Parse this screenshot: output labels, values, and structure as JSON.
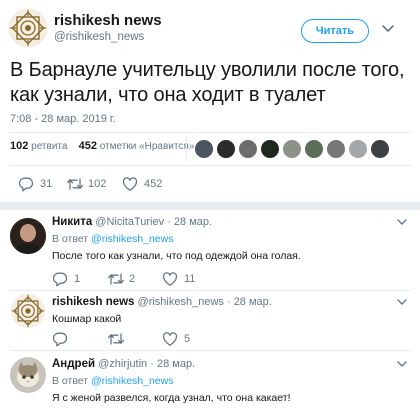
{
  "tweet": {
    "author_name": "rishikesh news",
    "author_handle": "@rishikesh_news",
    "follow_label": "Читать",
    "text": "В Барнауле учительцу уволили после того, как узнали, что она ходит в туалет",
    "time": "7:08 - 28 мар. 2019 г.",
    "retweets_count": "102",
    "retweets_label": "ретвита",
    "likes_count": "452",
    "likes_label": "отметки «Нравится»",
    "actions": {
      "reply": "31",
      "retweet": "102",
      "like": "452"
    }
  },
  "replies": [
    {
      "name": "Никита",
      "handle": "@NicitaTuriev",
      "date": "· 28 мар.",
      "reply_to_prefix": "В ответ",
      "reply_to_handle": "@rishikesh_news",
      "text": "После того как узнали, что под одеждой она голая.",
      "actions": {
        "reply": "1",
        "retweet": "2",
        "like": "11"
      }
    },
    {
      "name": "rishikesh news",
      "handle": "@rishikesh_news",
      "date": "· 28 мар.",
      "text": "Кошмар какой",
      "actions": {
        "reply": "",
        "retweet": "",
        "like": "5"
      }
    },
    {
      "name": "Андрей",
      "handle": "@zhirjutin",
      "date": "· 28 мар.",
      "reply_to_prefix": "В ответ",
      "reply_to_handle": "@rishikesh_news",
      "text": "Я с женой развелся, когда узнал, что она какает!"
    }
  ],
  "colors": {
    "accent": "#1da1f2",
    "muted": "#657786",
    "divider": "#e6ecf0"
  },
  "icons": [
    "reply-icon",
    "retweet-icon",
    "like-icon",
    "chevron-down-icon"
  ]
}
